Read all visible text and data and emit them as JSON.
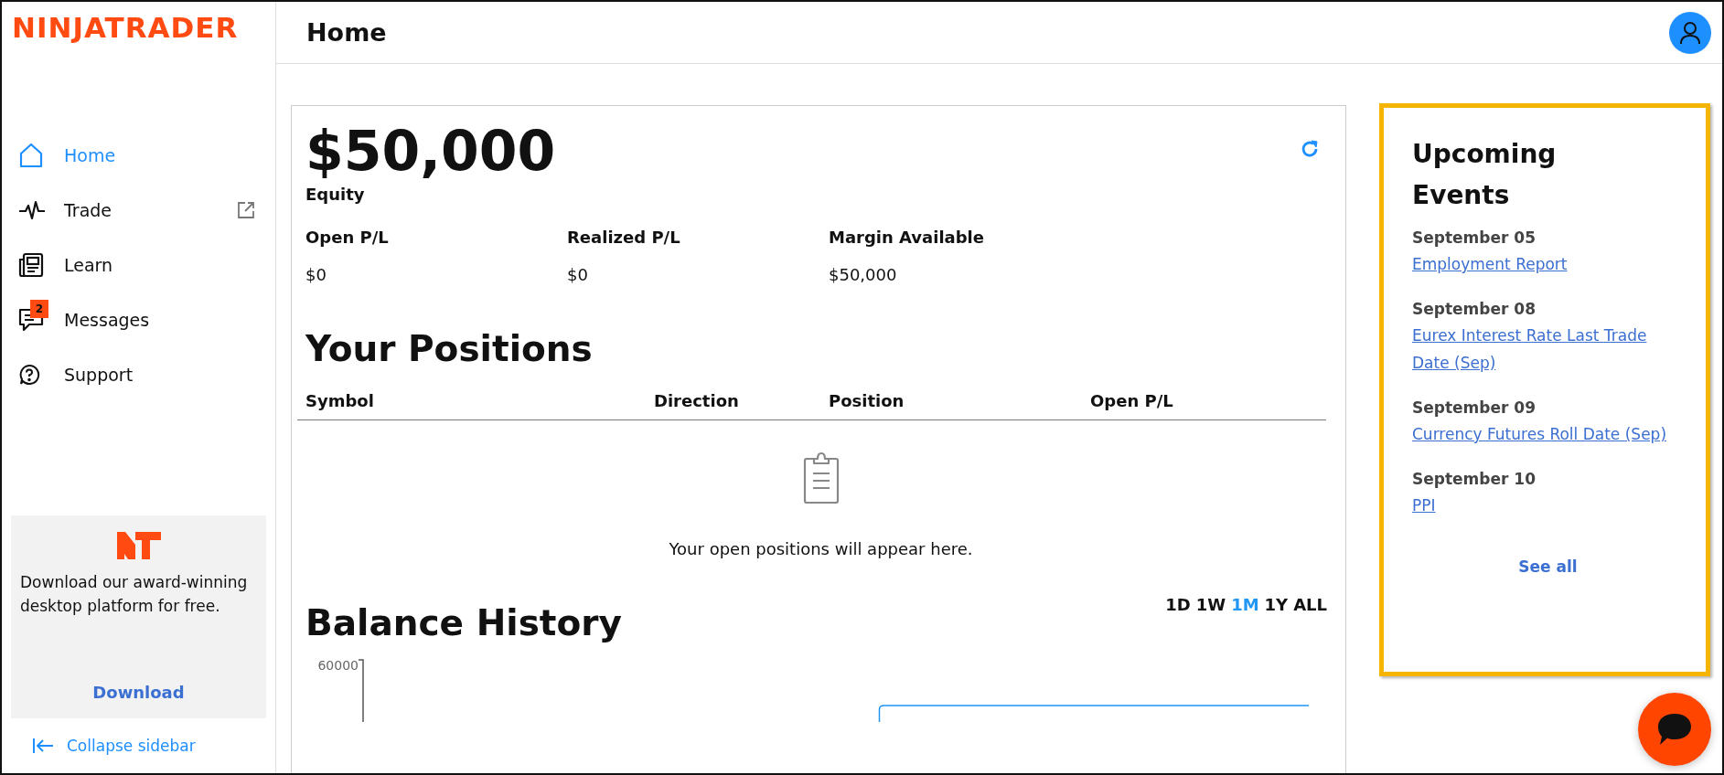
{
  "brand": {
    "logo": "NINJATRADER"
  },
  "sidebar": {
    "items": [
      {
        "label": "Home",
        "kind": "home",
        "selected": true,
        "external": false
      },
      {
        "label": "Trade",
        "kind": "trade",
        "selected": false,
        "external": true
      },
      {
        "label": "Learn",
        "kind": "learn",
        "selected": false,
        "external": false
      },
      {
        "label": "Messages",
        "kind": "messages",
        "selected": false,
        "external": false,
        "badge": "2"
      },
      {
        "label": "Support",
        "kind": "support",
        "selected": false,
        "external": false
      }
    ],
    "promo": {
      "text": "Download our award-winning desktop platform for free.",
      "button": "Download"
    },
    "collapse": "Collapse sidebar"
  },
  "header": {
    "title": "Home"
  },
  "account": {
    "equity": "$50,000",
    "equity_label": "Equity",
    "stats": [
      {
        "label": "Open P/L",
        "value": "$0"
      },
      {
        "label": "Realized P/L",
        "value": "$0"
      },
      {
        "label": "Margin Available",
        "value": "$50,000"
      }
    ]
  },
  "positions": {
    "title": "Your Positions",
    "columns": [
      "Symbol",
      "Direction",
      "Position",
      "Open P/L"
    ],
    "empty_message": "Your open positions will appear here."
  },
  "balance_history": {
    "title": "Balance History",
    "ranges": [
      {
        "label": "1D",
        "selected": false
      },
      {
        "label": "1W",
        "selected": false
      },
      {
        "label": "1M",
        "selected": true
      },
      {
        "label": "1Y",
        "selected": false
      },
      {
        "label": "ALL",
        "selected": false
      }
    ],
    "y_tick": "60000"
  },
  "upcoming_events": {
    "title": "Upcoming Events",
    "events": [
      {
        "date": "September 05",
        "name": "Employment Report"
      },
      {
        "date": "September 08",
        "name": "Eurex Interest Rate Last Trade Date (Sep)"
      },
      {
        "date": "September 09",
        "name": "Currency Futures Roll Date (Sep)"
      },
      {
        "date": "September 10",
        "name": "PPI"
      }
    ],
    "see_all": "See all"
  }
}
